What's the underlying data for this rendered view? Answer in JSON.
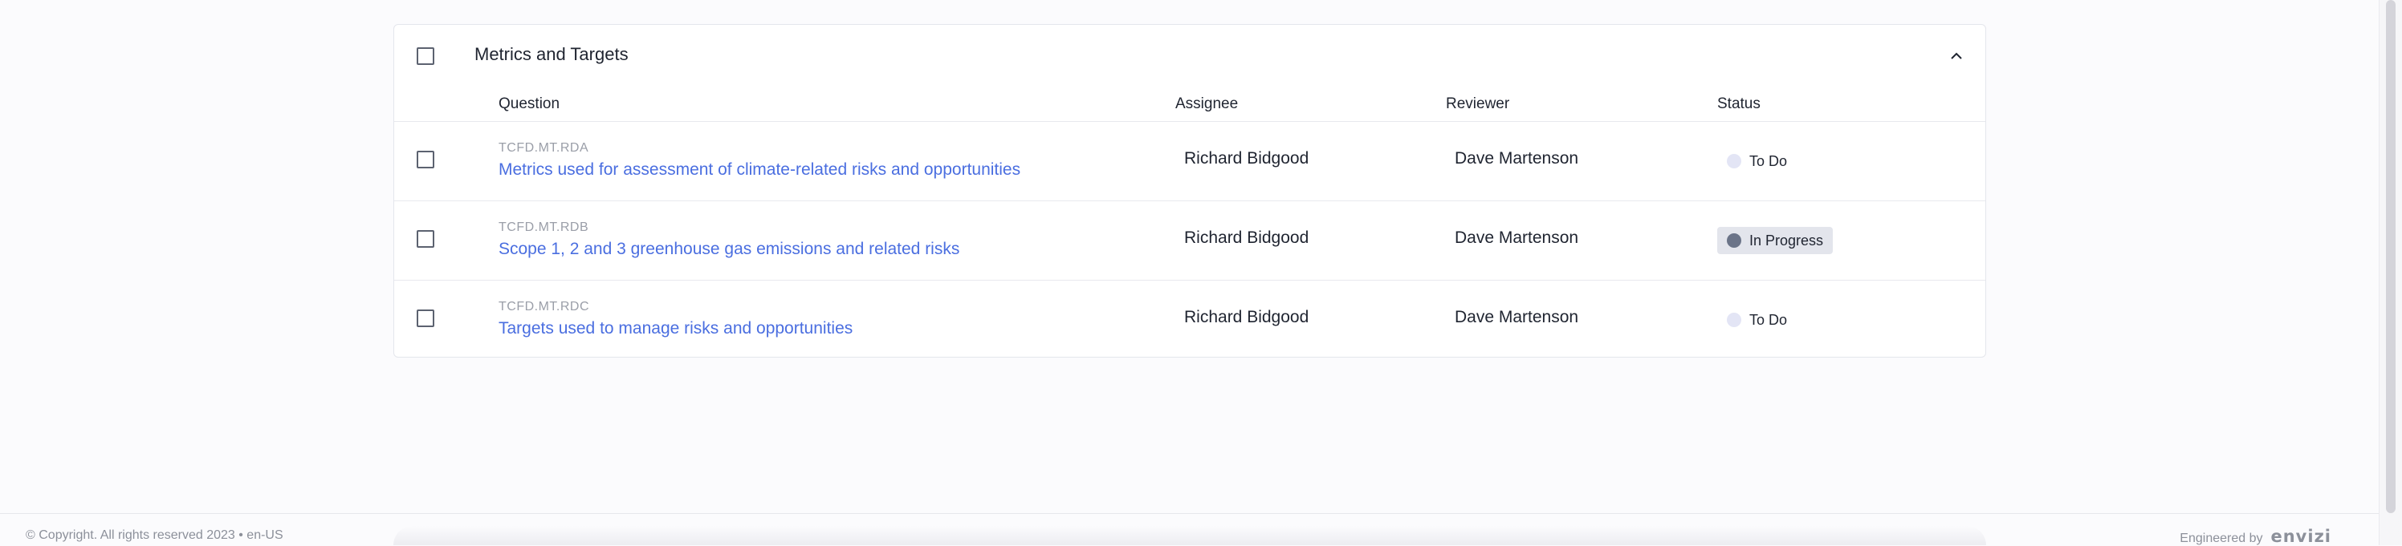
{
  "section": {
    "title": "Metrics and Targets"
  },
  "columns": {
    "question": "Question",
    "assignee": "Assignee",
    "reviewer": "Reviewer",
    "status": "Status"
  },
  "rows": [
    {
      "code": "TCFD.MT.RDA",
      "title": "Metrics used for assessment of climate-related risks and opportunities",
      "assignee": "Richard Bidgood",
      "reviewer": "Dave Martenson",
      "status": "To Do",
      "status_color": "#e3e5f5"
    },
    {
      "code": "TCFD.MT.RDB",
      "title": "Scope 1, 2 and 3 greenhouse gas emissions and related risks",
      "assignee": "Richard Bidgood",
      "reviewer": "Dave Martenson",
      "status": "In Progress",
      "status_color": "#6b7488"
    },
    {
      "code": "TCFD.MT.RDC",
      "title": "Targets used to manage risks and opportunities",
      "assignee": "Richard Bidgood",
      "reviewer": "Dave Martenson",
      "status": "To Do",
      "status_color": "#e3e5f5"
    }
  ],
  "footer": {
    "copyright": "© Copyright. All rights reserved 2023 • en-US",
    "engineered_by": "Engineered by",
    "brand": "envizi"
  },
  "colors": {
    "link": "#4a6ee0",
    "border": "#e4e6ec"
  },
  "icons": {
    "collapse": "chevron-up-icon"
  }
}
